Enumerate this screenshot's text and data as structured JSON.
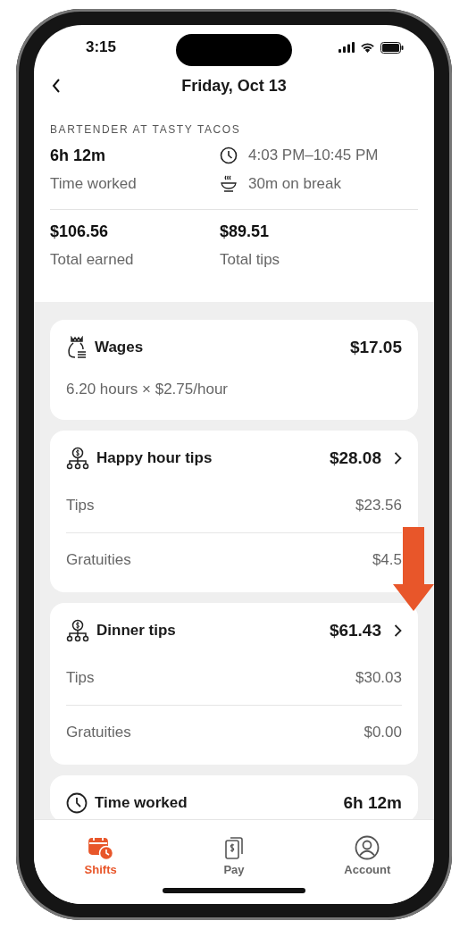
{
  "status_bar": {
    "time": "3:15"
  },
  "header": {
    "title": "Friday, Oct 13"
  },
  "shift": {
    "role": "BARTENDER AT TASTY TACOS",
    "duration": "6h 12m",
    "duration_label": "Time worked",
    "time_range": "4:03 PM–10:45 PM",
    "break": "30m on break",
    "total_earned": "$106.56",
    "total_earned_label": "Total earned",
    "total_tips": "$89.51",
    "total_tips_label": "Total tips"
  },
  "cards": [
    {
      "kind": "wages",
      "title": "Wages",
      "amount": "$17.05",
      "note": "6.20 hours × $2.75/hour"
    },
    {
      "kind": "tips",
      "title": "Happy hour tips",
      "amount": "$28.08",
      "rows": [
        {
          "label": "Tips",
          "value": "$23.56"
        },
        {
          "label": "Gratuities",
          "value": "$4.5"
        }
      ]
    },
    {
      "kind": "tips",
      "title": "Dinner tips",
      "amount": "$61.43",
      "rows": [
        {
          "label": "Tips",
          "value": "$30.03"
        },
        {
          "label": "Gratuities",
          "value": "$0.00"
        }
      ]
    },
    {
      "kind": "time",
      "title": "Time worked",
      "amount": "6h 12m"
    }
  ],
  "tabs": [
    {
      "label": "Shifts",
      "selected": true
    },
    {
      "label": "Pay",
      "selected": false
    },
    {
      "label": "Account",
      "selected": false
    }
  ]
}
